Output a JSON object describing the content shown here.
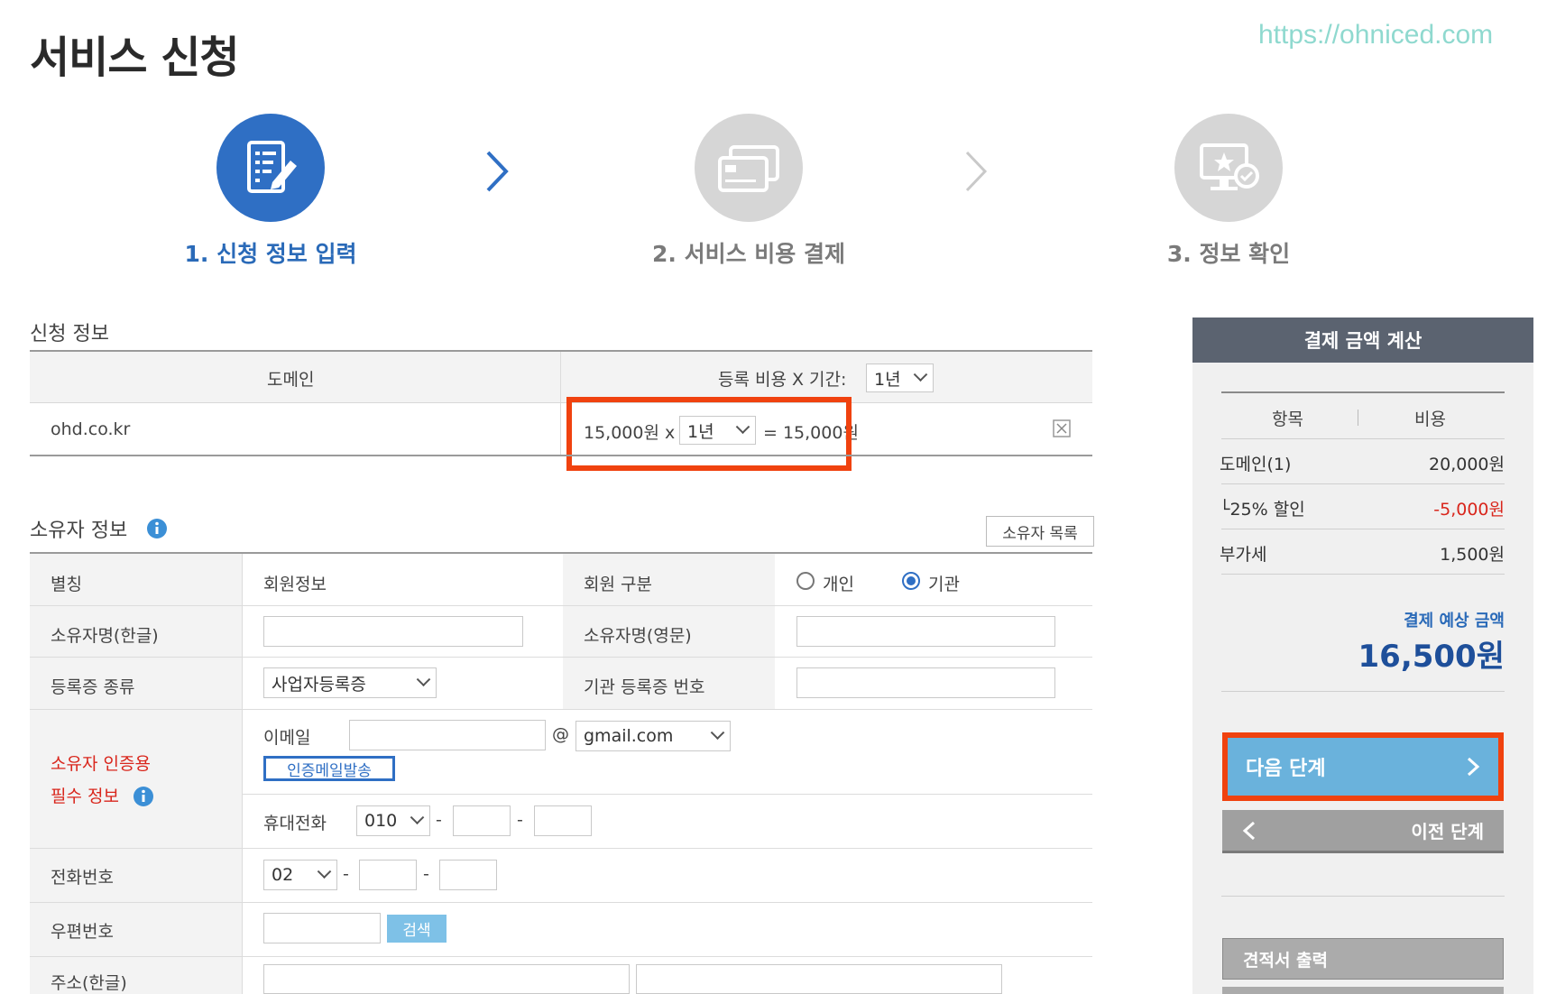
{
  "page": {
    "title": "서비스 신청",
    "watermark": "https://ohniced.com"
  },
  "steps": [
    {
      "label": "1. 신청 정보 입력",
      "icon": "form-edit-icon",
      "active": true
    },
    {
      "label": "2. 서비스 비용 결제",
      "icon": "credit-card-icon",
      "active": false
    },
    {
      "label": "3. 정보 확인",
      "icon": "monitor-check-icon",
      "active": false
    }
  ],
  "application": {
    "section_title": "신청 정보",
    "col_domain": "도메인",
    "col_cost_label": "등록 비용 X 기간:",
    "col_period_value": "1년",
    "row": {
      "domain": "ohd.co.kr",
      "unit_price": "15,000원 x",
      "period": "1년",
      "total": "= 15,000원"
    }
  },
  "owner": {
    "section_title": "소유자 정보",
    "list_button": "소유자 목록",
    "alias_label": "별칭",
    "alias_value": "회원정보",
    "member_type_label": "회원 구분",
    "member_type_options": [
      "개인",
      "기관"
    ],
    "member_type_selected": "기관",
    "name_kr_label": "소유자명(한글)",
    "name_en_label": "소유자명(영문)",
    "reg_type_label": "등록증 종류",
    "reg_type_value": "사업자등록증",
    "org_reg_label": "기관 등록증 번호",
    "auth_label_1": "소유자 인증용",
    "auth_label_2": "필수 정보",
    "email_label": "이메일",
    "email_at": "@",
    "email_domain": "gmail.com",
    "send_auth_mail": "인증메일발송",
    "mobile_label": "휴대전화",
    "mobile_prefix": "010",
    "phone_label": "전화번호",
    "phone_prefix": "02",
    "dash": "-",
    "zip_label": "우편번호",
    "zip_search": "검색",
    "address_label": "주소(한글)"
  },
  "summary": {
    "header": "결제 금액 계산",
    "col_item": "항목",
    "col_cost": "비용",
    "rows": [
      {
        "label": "도메인(1)",
        "value": "20,000원"
      },
      {
        "label": "└25% 할인",
        "value": "-5,000원"
      },
      {
        "label": "부가세",
        "value": "1,500원"
      }
    ],
    "estimate_label": "결제 예상 금액",
    "estimate_value": "16,500원",
    "next_button": "다음 단계",
    "prev_button": "이전 단계",
    "quote_button": "견적서 출력"
  },
  "colors": {
    "accent_blue": "#2f6fc4",
    "highlight_red": "#f0420f",
    "discount_red": "#d9261c"
  }
}
